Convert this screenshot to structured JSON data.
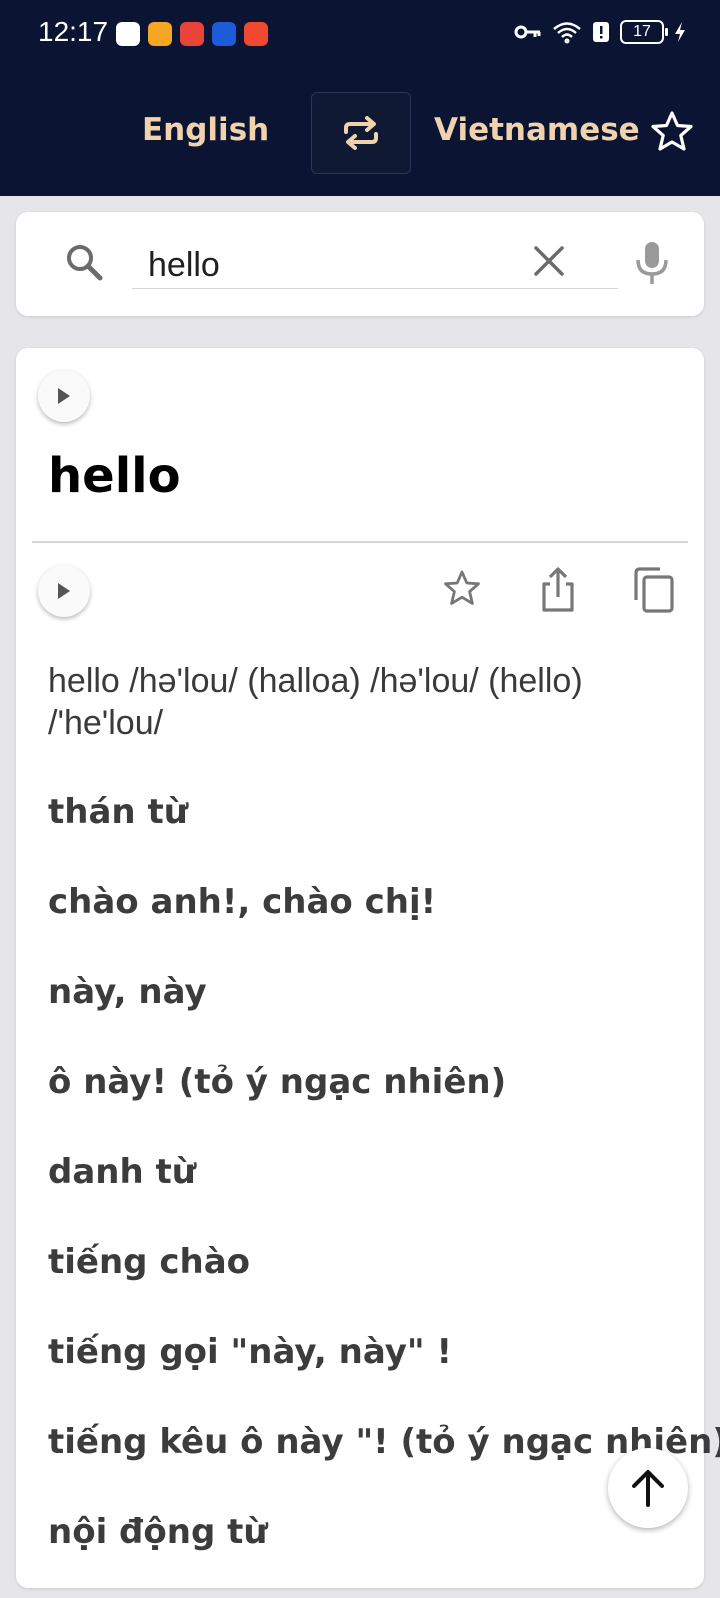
{
  "status_bar": {
    "time": "12:17",
    "battery": "17",
    "notification_icons": [
      {
        "name": "app-notification-icon",
        "color": "#ffffff"
      },
      {
        "name": "app-notification-icon",
        "color": "#f5a623"
      },
      {
        "name": "app-notification-icon",
        "color": "#e8443a"
      },
      {
        "name": "app-notification-icon",
        "color": "#1e5bd8"
      },
      {
        "name": "app-notification-icon",
        "color": "#f0492f"
      }
    ]
  },
  "header": {
    "source_language": "English",
    "target_language": "Vietnamese",
    "accent_color": "#f0d3ad",
    "background_color": "#0b1433"
  },
  "search": {
    "value": "hello"
  },
  "result": {
    "headword": "hello",
    "phonetic": "hello /hə'lou/ (halloa) /hə'lou/ (hello) /'he'lou/",
    "meanings": [
      "thán từ",
      "chào anh!, chào chị!",
      "này, này",
      "ô này! (tỏ ý ngạc nhiên)",
      "danh từ",
      "tiếng chào",
      "tiếng gọi \"này, này\" !",
      "tiếng kêu ô này \"! (tỏ ý ngạc nhiên)",
      "nội động từ"
    ]
  }
}
